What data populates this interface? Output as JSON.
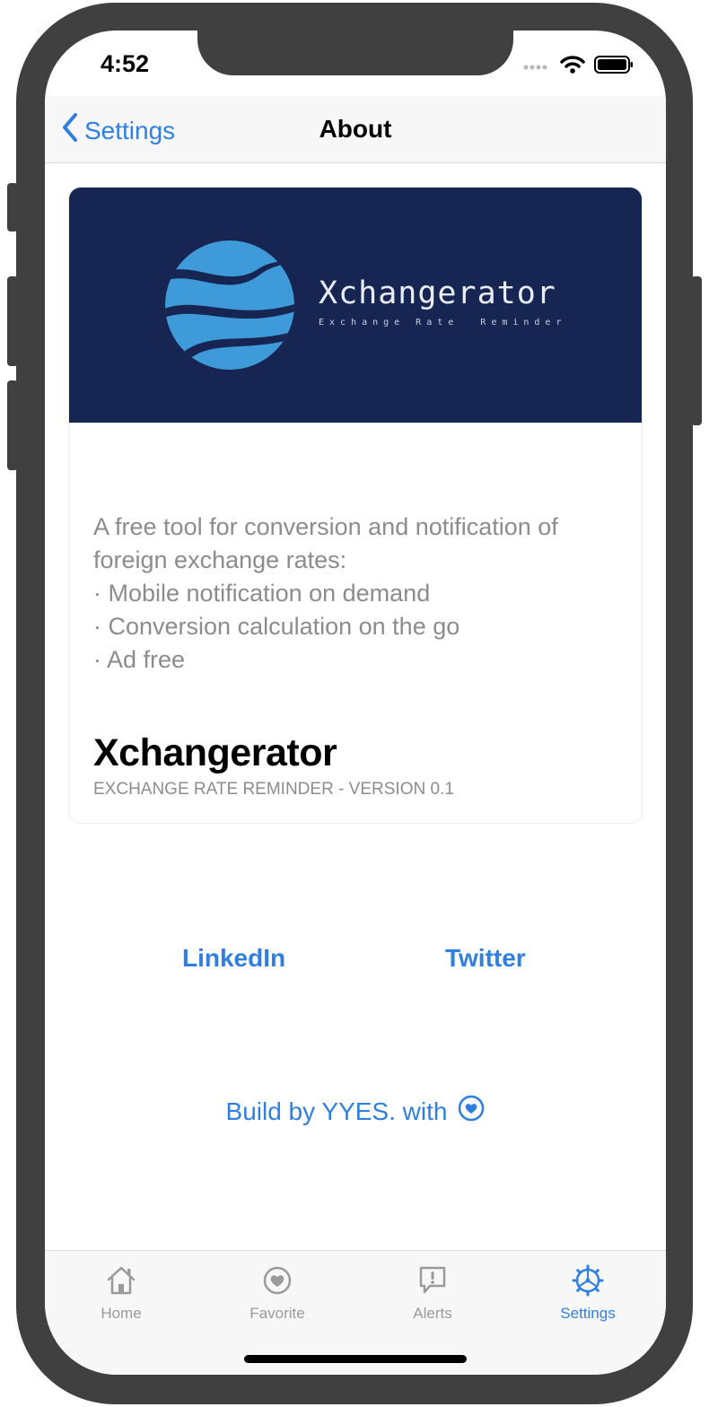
{
  "status_bar": {
    "time": "4:52"
  },
  "nav": {
    "back_label": "Settings",
    "title": "About"
  },
  "banner": {
    "app_name": "Xchangerator",
    "tagline": "Exchange Rate  Reminder"
  },
  "description": {
    "intro": "A free tool for conversion and notification of foreign exchange rates:",
    "bullets": [
      "· Mobile notification on demand",
      "· Conversion calculation on the go",
      "· Ad free"
    ]
  },
  "app_info": {
    "name": "Xchangerator",
    "version_line": "EXCHANGE RATE REMINDER - VERSION 0.1"
  },
  "links": {
    "linkedin": "LinkedIn",
    "twitter": "Twitter"
  },
  "credit": {
    "text": "Build by YYES. with",
    "icon": "heart-icon"
  },
  "tabs": [
    {
      "label": "Home",
      "icon": "home-icon",
      "active": false
    },
    {
      "label": "Favorite",
      "icon": "heart-icon",
      "active": false
    },
    {
      "label": "Alerts",
      "icon": "alert-icon",
      "active": false
    },
    {
      "label": "Settings",
      "icon": "gear-icon",
      "active": true
    }
  ],
  "colors": {
    "accent": "#2f7fe0",
    "banner_bg": "#172552",
    "logo_blue": "#3f9ad9",
    "inactive": "#9a9a9a"
  }
}
